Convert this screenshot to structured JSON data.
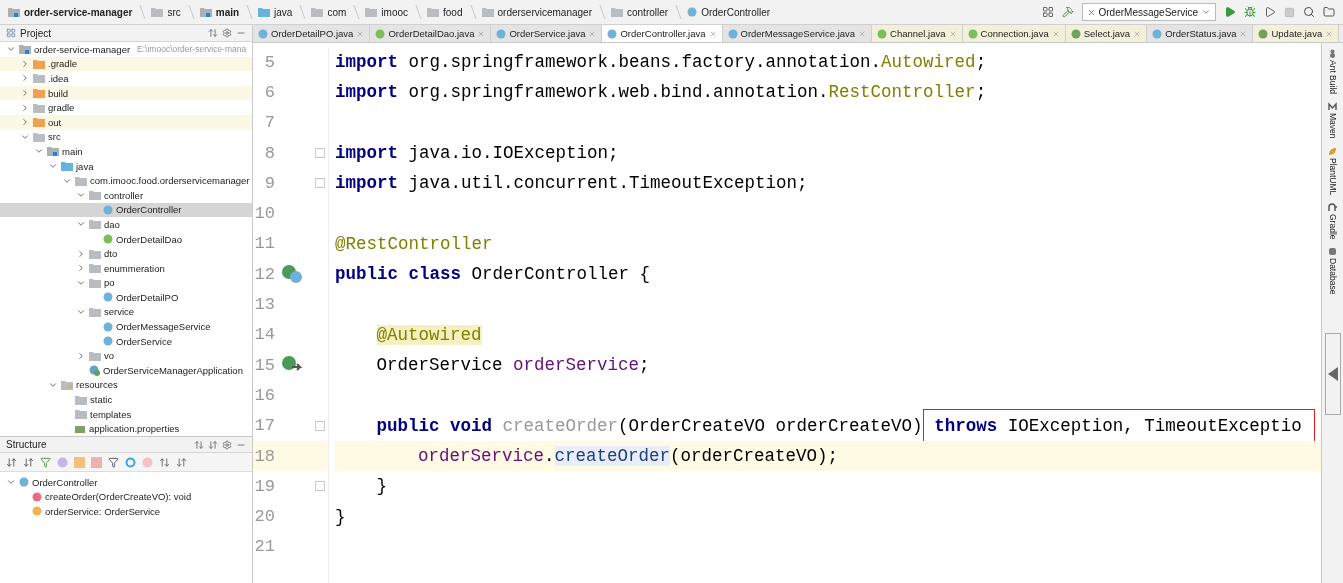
{
  "breadcrumbs": [
    {
      "label": "order-service-manager",
      "kind": "module",
      "bold": true
    },
    {
      "label": "src",
      "kind": "folder",
      "bold": false
    },
    {
      "label": "main",
      "kind": "module",
      "bold": true
    },
    {
      "label": "java",
      "kind": "source-root",
      "bold": false
    },
    {
      "label": "com",
      "kind": "folder",
      "bold": false
    },
    {
      "label": "imooc",
      "kind": "folder",
      "bold": false
    },
    {
      "label": "food",
      "kind": "folder",
      "bold": false
    },
    {
      "label": "orderservicemanager",
      "kind": "folder",
      "bold": false
    },
    {
      "label": "controller",
      "kind": "folder",
      "bold": false
    },
    {
      "label": "OrderController",
      "kind": "class",
      "bold": false
    }
  ],
  "run_config": {
    "label": "OrderMessageService"
  },
  "project_panel": {
    "title": "Project",
    "tree": [
      {
        "label": "order-service-manager",
        "kind": "module",
        "path": "E:\\imooc\\order-service-mana",
        "expanded": true,
        "selected": false,
        "children": [
          {
            "label": ".gradle",
            "kind": "excluded",
            "expanded": false,
            "selected": false
          },
          {
            "label": ".idea",
            "kind": "folder",
            "expanded": false,
            "selected": false
          },
          {
            "label": "build",
            "kind": "excluded",
            "expanded": false,
            "selected": false
          },
          {
            "label": "gradle",
            "kind": "folder",
            "expanded": false,
            "selected": false
          },
          {
            "label": "out",
            "kind": "excluded",
            "expanded": false,
            "selected": false
          },
          {
            "label": "src",
            "kind": "folder",
            "expanded": true,
            "selected": false,
            "children": [
              {
                "label": "main",
                "kind": "module",
                "expanded": true,
                "selected": false,
                "children": [
                  {
                    "label": "java",
                    "kind": "source-root",
                    "expanded": true,
                    "selected": false,
                    "children": [
                      {
                        "label": "com.imooc.food.orderservicemanager",
                        "kind": "package",
                        "expanded": true,
                        "selected": false,
                        "children": [
                          {
                            "label": "controller",
                            "kind": "package",
                            "expanded": true,
                            "selected": false,
                            "children": [
                              {
                                "label": "OrderController",
                                "kind": "class",
                                "selected": true
                              }
                            ]
                          },
                          {
                            "label": "dao",
                            "kind": "package",
                            "expanded": true,
                            "selected": false,
                            "children": [
                              {
                                "label": "OrderDetailDao",
                                "kind": "interface",
                                "selected": false
                              }
                            ]
                          },
                          {
                            "label": "dto",
                            "kind": "package",
                            "expanded": false,
                            "selected": false
                          },
                          {
                            "label": "enummeration",
                            "kind": "package",
                            "expanded": false,
                            "selected": false
                          },
                          {
                            "label": "po",
                            "kind": "package",
                            "expanded": true,
                            "selected": false,
                            "children": [
                              {
                                "label": "OrderDetailPO",
                                "kind": "class",
                                "selected": false
                              }
                            ]
                          },
                          {
                            "label": "service",
                            "kind": "package",
                            "expanded": true,
                            "selected": false,
                            "children": [
                              {
                                "label": "OrderMessageService",
                                "kind": "class",
                                "selected": false
                              },
                              {
                                "label": "OrderService",
                                "kind": "class",
                                "selected": false
                              }
                            ]
                          },
                          {
                            "label": "vo",
                            "kind": "package",
                            "expanded": false,
                            "selected": false
                          },
                          {
                            "label": "OrderServiceManagerApplication",
                            "kind": "spring",
                            "selected": false
                          }
                        ]
                      }
                    ]
                  },
                  {
                    "label": "resources",
                    "kind": "resources",
                    "expanded": true,
                    "selected": false,
                    "children": [
                      {
                        "label": "static",
                        "kind": "package",
                        "selected": false
                      },
                      {
                        "label": "templates",
                        "kind": "package",
                        "selected": false
                      },
                      {
                        "label": "application.properties",
                        "kind": "properties",
                        "selected": false
                      }
                    ]
                  }
                ]
              }
            ]
          }
        ]
      }
    ]
  },
  "structure_panel": {
    "title": "Structure",
    "tree": [
      {
        "label": "OrderController",
        "kind": "class",
        "expanded": true,
        "children": [
          {
            "label": "createOrder(OrderCreateVO): void",
            "kind": "method"
          },
          {
            "label": "orderService: OrderService",
            "kind": "field"
          }
        ]
      }
    ]
  },
  "tabs": [
    {
      "label": "OrderDetailPO.java",
      "kind": "class",
      "selected": false,
      "tinted": false
    },
    {
      "label": "OrderDetailDao.java",
      "kind": "interface",
      "selected": false,
      "tinted": false
    },
    {
      "label": "OrderService.java",
      "kind": "class",
      "selected": false,
      "tinted": false
    },
    {
      "label": "OrderController.java",
      "kind": "class",
      "selected": true,
      "tinted": false
    },
    {
      "label": "OrderMessageService.java",
      "kind": "class",
      "selected": false,
      "tinted": false
    },
    {
      "label": "Channel.java",
      "kind": "interface",
      "selected": false,
      "tinted": true
    },
    {
      "label": "Connection.java",
      "kind": "interface",
      "selected": false,
      "tinted": true
    },
    {
      "label": "Select.java",
      "kind": "annotation",
      "selected": false,
      "tinted": true
    },
    {
      "label": "OrderStatus.java",
      "kind": "class",
      "selected": false,
      "tinted": false
    },
    {
      "label": "Update.java",
      "kind": "annotation",
      "selected": false,
      "tinted": true
    }
  ],
  "editor": {
    "lines": [
      {
        "number": "5",
        "current": false,
        "kind": "plain",
        "tokens": [
          {
            "kind": "keyword",
            "text": "import"
          },
          {
            "kind": "plain",
            "text": " org.springframework.beans.factory.annotation."
          },
          {
            "kind": "annotation",
            "text": "Autowired"
          },
          {
            "kind": "plain",
            "text": ";"
          }
        ]
      },
      {
        "number": "6",
        "current": false,
        "kind": "plain",
        "tokens": [
          {
            "kind": "keyword",
            "text": "import"
          },
          {
            "kind": "plain",
            "text": " org.springframework.web.bind.annotation."
          },
          {
            "kind": "annotation",
            "text": "RestController"
          },
          {
            "kind": "plain",
            "text": ";"
          }
        ]
      },
      {
        "number": "7",
        "current": false,
        "kind": "plain"
      },
      {
        "number": "8",
        "current": false,
        "kind": "plain",
        "fold": true,
        "tokens": [
          {
            "kind": "keyword",
            "text": "import"
          },
          {
            "kind": "plain",
            "text": " java.io.IOException;"
          }
        ]
      },
      {
        "number": "9",
        "current": false,
        "kind": "plain",
        "fold": true,
        "tokens": [
          {
            "kind": "keyword",
            "text": "import"
          },
          {
            "kind": "plain",
            "text": " java.util.concurrent.TimeoutException;"
          }
        ]
      },
      {
        "number": "10",
        "current": false,
        "kind": "plain"
      },
      {
        "number": "11",
        "current": false,
        "kind": "plain",
        "tokens": [
          {
            "kind": "annotation",
            "text": "@RestController"
          }
        ]
      },
      {
        "number": "12",
        "current": false,
        "kind": "bean-class",
        "tokens": [
          {
            "kind": "keyword",
            "text": "public class"
          },
          {
            "kind": "plain",
            "text": " OrderController {"
          }
        ]
      },
      {
        "number": "13",
        "current": false,
        "kind": "plain"
      },
      {
        "number": "14",
        "current": false,
        "kind": "plain",
        "in_class": true,
        "tokens": [
          {
            "kind": "marked-annotation",
            "text": "@Autowired"
          }
        ]
      },
      {
        "number": "15",
        "current": false,
        "kind": "bean-link",
        "in_class": true,
        "tokens": [
          {
            "kind": "plain",
            "text": "OrderService "
          },
          {
            "kind": "field",
            "text": "orderService"
          },
          {
            "kind": "plain",
            "text": ";"
          }
        ]
      },
      {
        "number": "16",
        "current": false,
        "kind": "plain"
      },
      {
        "number": "17",
        "current": false,
        "kind": "plain",
        "in_class": true,
        "fold": true,
        "tokens": [
          {
            "kind": "keyword",
            "text": "public void "
          },
          {
            "kind": "unused",
            "text": "createOrder"
          },
          {
            "kind": "plain",
            "text": "(OrderCreateVO orderCreateVO)"
          },
          {
            "kind": "keyword",
            "text": " throws",
            "boxed": true
          },
          {
            "kind": "plain",
            "text": " IOException, TimeoutExceptio",
            "boxed": true
          }
        ]
      },
      {
        "number": "18",
        "current": true,
        "kind": "plain",
        "in_class": true,
        "in_method": true,
        "tokens": [
          {
            "kind": "field",
            "text": "orderService"
          },
          {
            "kind": "plain",
            "text": "."
          },
          {
            "kind": "marked-method",
            "text": "createOrder"
          },
          {
            "kind": "plain",
            "text": "(orderCreateVO);"
          }
        ]
      },
      {
        "number": "19",
        "current": false,
        "kind": "plain",
        "in_class": true,
        "fold": true,
        "tokens": [
          {
            "kind": "plain",
            "text": "}"
          }
        ]
      },
      {
        "number": "20",
        "current": false,
        "kind": "plain",
        "tokens": [
          {
            "kind": "plain",
            "text": "}"
          }
        ]
      },
      {
        "number": "21",
        "current": false,
        "kind": "plain"
      }
    ]
  },
  "tool_strip": [
    {
      "label": "Ant Build",
      "kind": "ant"
    },
    {
      "label": "Maven",
      "kind": "maven"
    },
    {
      "label": "PlantUML",
      "kind": "plantuml"
    },
    {
      "label": "Gradle",
      "kind": "gradle"
    },
    {
      "label": "Database",
      "kind": "database"
    }
  ]
}
